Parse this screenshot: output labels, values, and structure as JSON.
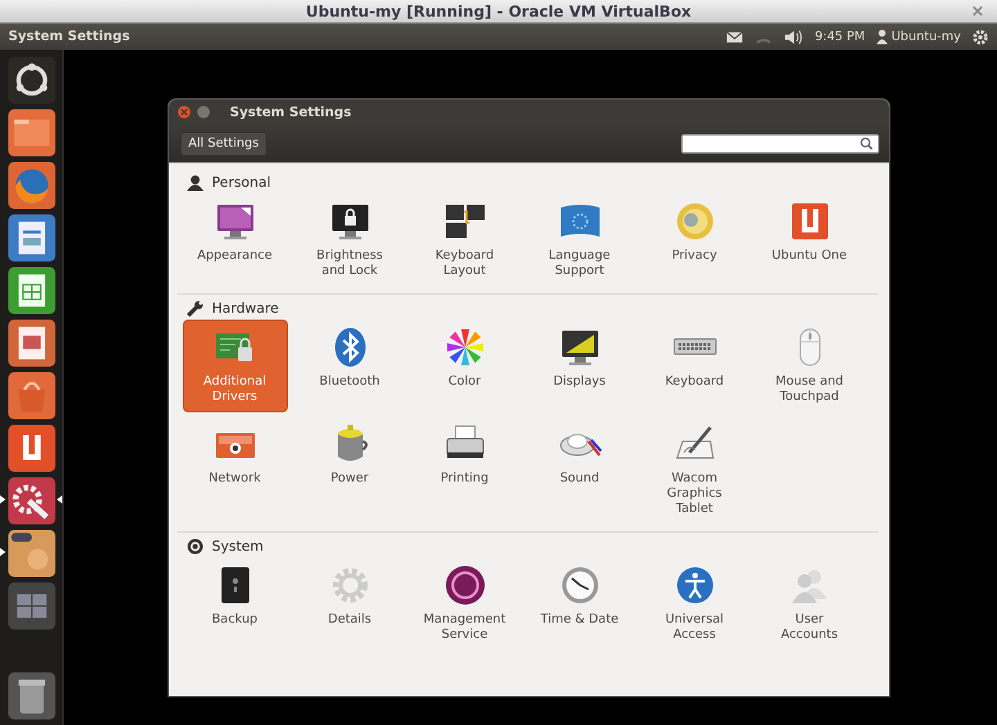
{
  "vbox": {
    "title": "Ubuntu-my [Running] - Oracle VM VirtualBox"
  },
  "panel": {
    "app": "System Settings",
    "clock": "9:45 PM",
    "user": "Ubuntu-my"
  },
  "launcher": [
    {
      "running": false,
      "focused": false
    },
    {
      "running": false,
      "focused": false
    },
    {
      "running": false,
      "focused": false
    },
    {
      "running": false,
      "focused": false
    },
    {
      "running": false,
      "focused": false
    },
    {
      "running": false,
      "focused": false
    },
    {
      "running": false,
      "focused": false
    },
    {
      "running": false,
      "focused": false
    },
    {
      "running": true,
      "focused": true
    },
    {
      "running": true,
      "focused": false
    },
    {
      "running": false,
      "focused": false
    },
    {
      "running": false,
      "focused": false
    }
  ],
  "window": {
    "title": "System Settings",
    "all_settings": "All Settings"
  },
  "sections": [
    {
      "title": "Personal",
      "items": [
        {
          "label": "Appearance",
          "selected": false
        },
        {
          "label": "Brightness and Lock",
          "selected": false
        },
        {
          "label": "Keyboard Layout",
          "selected": false
        },
        {
          "label": "Language Support",
          "selected": false
        },
        {
          "label": "Privacy",
          "selected": false
        },
        {
          "label": "Ubuntu One",
          "selected": false
        }
      ]
    },
    {
      "title": "Hardware",
      "items": [
        {
          "label": "Additional Drivers",
          "selected": true
        },
        {
          "label": "Bluetooth",
          "selected": false
        },
        {
          "label": "Color",
          "selected": false
        },
        {
          "label": "Displays",
          "selected": false
        },
        {
          "label": "Keyboard",
          "selected": false
        },
        {
          "label": "Mouse and Touchpad",
          "selected": false
        },
        {
          "label": "Network",
          "selected": false
        },
        {
          "label": "Power",
          "selected": false
        },
        {
          "label": "Printing",
          "selected": false
        },
        {
          "label": "Sound",
          "selected": false
        },
        {
          "label": "Wacom Graphics Tablet",
          "selected": false
        }
      ]
    },
    {
      "title": "System",
      "items": [
        {
          "label": "Backup",
          "selected": false
        },
        {
          "label": "Details",
          "selected": false
        },
        {
          "label": "Management Service",
          "selected": false
        },
        {
          "label": "Time & Date",
          "selected": false
        },
        {
          "label": "Universal Access",
          "selected": false
        },
        {
          "label": "User Accounts",
          "selected": false
        }
      ]
    }
  ]
}
